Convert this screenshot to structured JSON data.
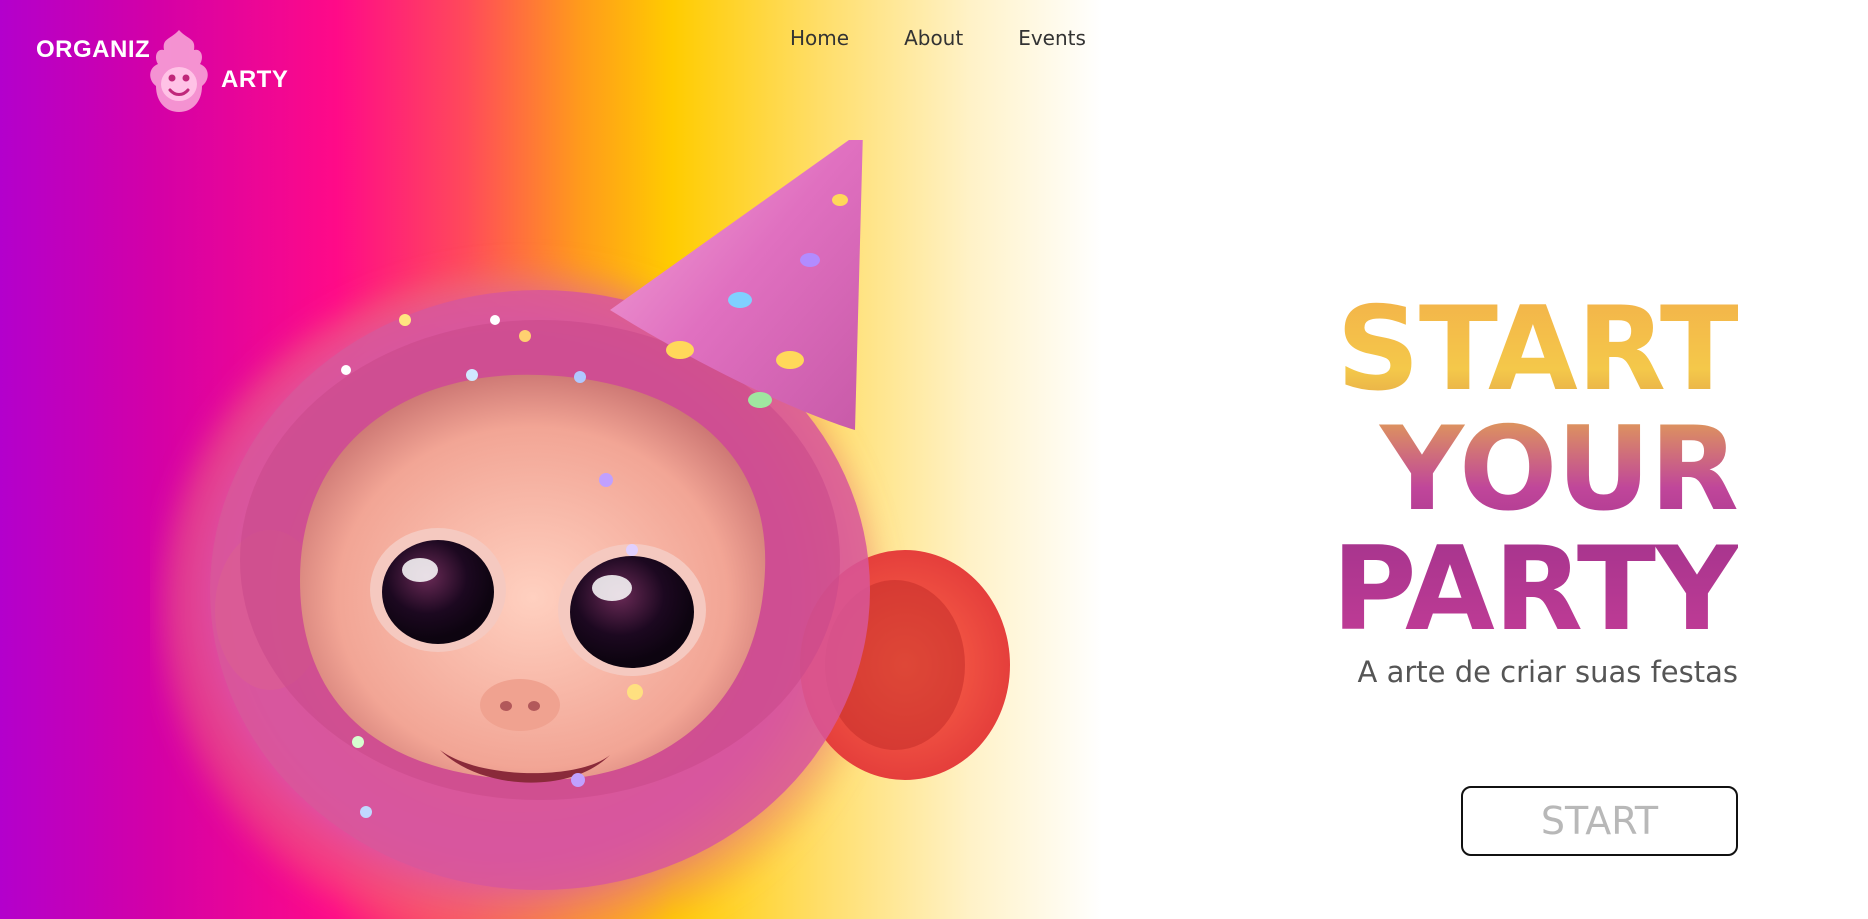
{
  "brand": {
    "logo_left": "ORGANIZ",
    "logo_right": "ARTY",
    "mark_icon": "monkey-logo-icon"
  },
  "nav": {
    "items": [
      {
        "label": "Home"
      },
      {
        "label": "About"
      },
      {
        "label": "Events"
      }
    ]
  },
  "hero": {
    "headline": [
      "START",
      "YOUR",
      "PARTY"
    ],
    "tagline": "A arte de criar suas festas",
    "cta_label": "START",
    "image_icon": "party-monkey-illustration"
  },
  "colors": {
    "gradient": [
      "#b300cc",
      "#ff0a88",
      "#ffcc00",
      "#ffffff"
    ],
    "headline_top": "#f4c84a",
    "headline_bottom": "#a8358e",
    "button_border": "#111111",
    "button_text": "#b8b8b8"
  }
}
